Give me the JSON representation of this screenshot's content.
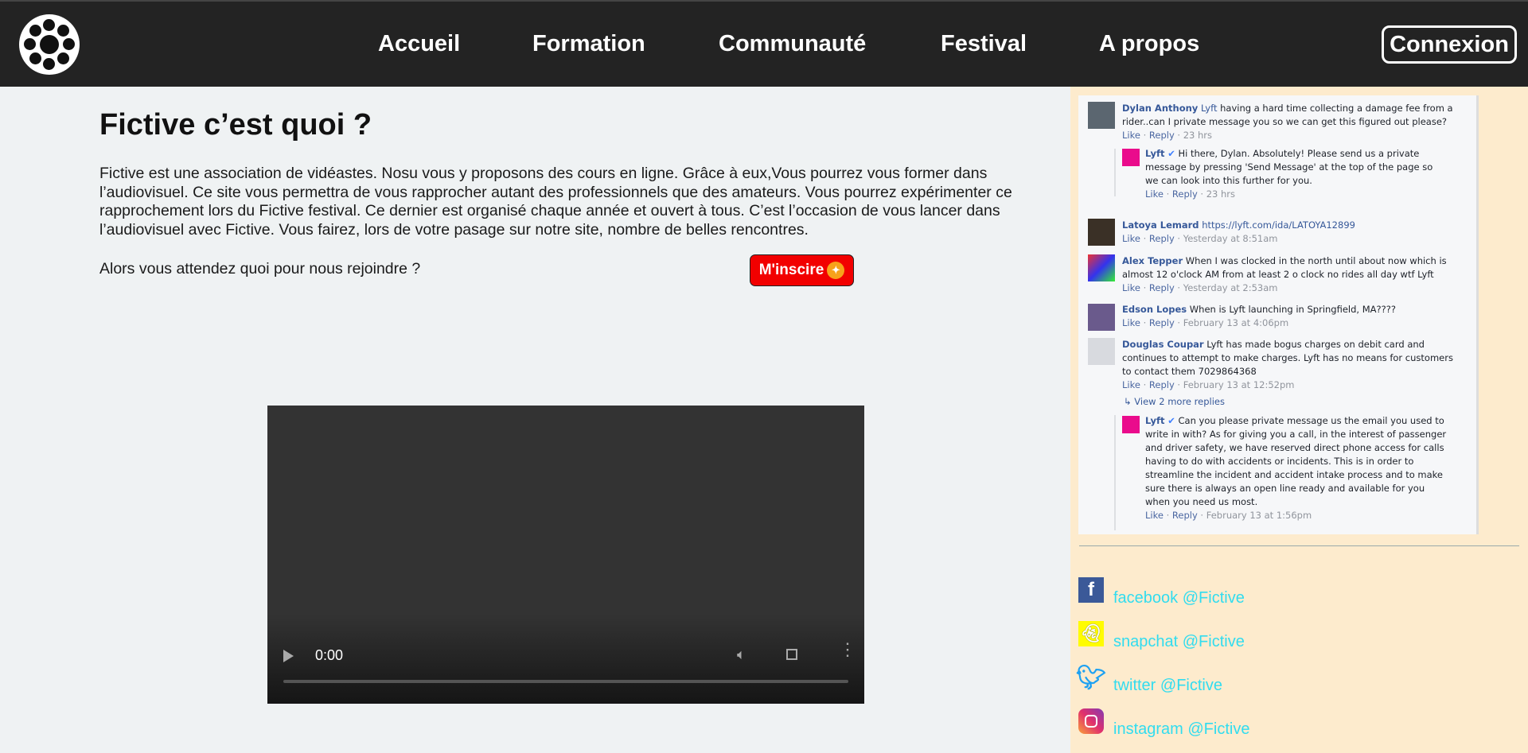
{
  "header": {
    "nav": [
      "Accueil",
      "Formation",
      "Communauté",
      "Festival",
      "A propos"
    ],
    "login_label": "Connexion"
  },
  "main": {
    "title": "Fictive c’est quoi ?",
    "paragraph": "Fictive est une association de vidéastes. Nosu vous y proposons des cours en ligne. Grâce à eux,Vous pourrez vous former dans l’audiovisuel. Ce site vous permettra de vous rapprocher autant des professionnels que des amateurs. Vous pourrez expérimenter ce rapprochement lors du Fictive festival. Ce dernier est organisé chaque année et ouvert à tous. C’est l’occasion de vous lancer dans l’audiovisuel avec Fictive. Vous fairez, lors de votre pasage sur notre site, nombre de belles rencontres.",
    "cta_text": "Alors vous attendez quoi pour nous rejoindre ?",
    "cta_button": "M'inscire",
    "video": {
      "time": "0:00"
    }
  },
  "comments": [
    {
      "name": "Dylan Anthony",
      "mention": "Lyft",
      "text": " having a hard time collecting a damage fee from a rider..can I private message you so we can get this figured out please?",
      "like": "Like",
      "reply": "Reply",
      "time": "23 hrs"
    },
    {
      "name": "Lyft",
      "text": "Hi there, Dylan. Absolutely! Please send us a private message by pressing 'Send Message' at the top of the page so we can look into this further for you.",
      "like": "Like",
      "reply": "Reply",
      "time": "23 hrs"
    },
    {
      "name": "Latoya Lemard",
      "text": "https://lyft.com/ida/LATOYA12899",
      "like": "Like",
      "reply": "Reply",
      "time": "Yesterday at 8:51am"
    },
    {
      "name": "Alex Tepper",
      "text": "When I was clocked in the north until about now which is almost 12 o'clock AM from at least 2 o clock no rides all day wtf Lyft",
      "like": "Like",
      "reply": "Reply",
      "time": "Yesterday at 2:53am"
    },
    {
      "name": "Edson Lopes",
      "text": "When is Lyft launching in Springfield, MA????",
      "like": "Like",
      "reply": "Reply",
      "time": "February 13 at 4:06pm"
    },
    {
      "name": "Douglas Coupar",
      "text": "Lyft has made bogus charges on debit card and continues to attempt to make charges. Lyft has no means for customers to contact them 7029864368",
      "like": "Like",
      "reply": "Reply",
      "time": "February 13 at 12:52pm"
    },
    {
      "view_more": "View 2 more replies"
    },
    {
      "name": "Lyft",
      "text": "Can you please private message us the email you used to write in with? As for giving you a call, in the interest of passenger and driver safety, we have reserved direct phone access for calls having to do with accidents or incidents. This is in order to streamline the incident and accident intake process and to make sure there is always an open line ready and available for you when you need us most.",
      "like": "Like",
      "reply": "Reply",
      "time": "February 13 at 1:56pm"
    }
  ],
  "social": [
    {
      "icon": "facebook-icon",
      "label": "facebook @Fictive",
      "color": "#3b5998"
    },
    {
      "icon": "snapchat-icon",
      "label": "snapchat @Fictive",
      "color": "#fffc00"
    },
    {
      "icon": "twitter-icon",
      "label": "twitter @Fictive",
      "color": "#1da1f2"
    },
    {
      "icon": "instagram-icon",
      "label": "instagram @Fictive",
      "color": "#d6249f"
    }
  ],
  "colors": {
    "header_bg": "#232323",
    "button_red": "#f20000",
    "sidebar_bg": "#fdebcd",
    "social_link": "#31dcef",
    "page_bg": "#eff2f3"
  }
}
